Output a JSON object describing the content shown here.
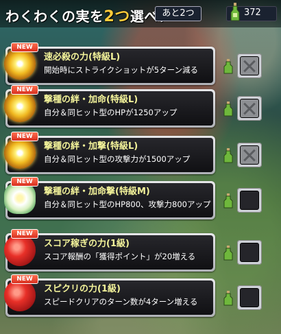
{
  "header": {
    "title_prefix": "わくわくの実を",
    "title_num": "2つ",
    "title_suffix": "選べ！",
    "remain_label": "あと2つ",
    "energy": "372"
  },
  "items": [
    {
      "name": "速必殺の力(特級L)",
      "desc": "開始時にストライクショットが5ターン減る",
      "new": "NEW",
      "icon": "sun-fruit-icon",
      "checked": true
    },
    {
      "name": "撃種の絆・加命(特級L)",
      "desc": "自分＆同ヒット型のHPが1250アップ",
      "new": "NEW",
      "icon": "sun-fruit-icon",
      "checked": true
    },
    {
      "name": "撃種の絆・加撃(特級L)",
      "desc": "自分＆同ヒット型の攻撃力が1500アップ",
      "new": "NEW",
      "icon": "sun-fruit-icon",
      "checked": true
    },
    {
      "name": "撃種の絆・加命撃(特級M)",
      "desc": "自分＆同ヒット型のHP800、攻撃力800アップ",
      "new": "NEW",
      "icon": "lotus-fruit-icon",
      "checked": false
    },
    {
      "name": "スコア稼ぎの力(1級)",
      "desc": "スコア報酬の「獲得ポイント」が20増える",
      "new": "NEW",
      "icon": "red-fruit-icon",
      "checked": false
    },
    {
      "name": "スピクリの力(1級)",
      "desc": "スピードクリアのターン数が4ターン増える",
      "new": "NEW",
      "icon": "red-fruit-icon",
      "checked": false
    }
  ],
  "colors": {
    "name": "#f3f39a",
    "accent": "#ffcc3a",
    "new_badge": "#e84030"
  }
}
